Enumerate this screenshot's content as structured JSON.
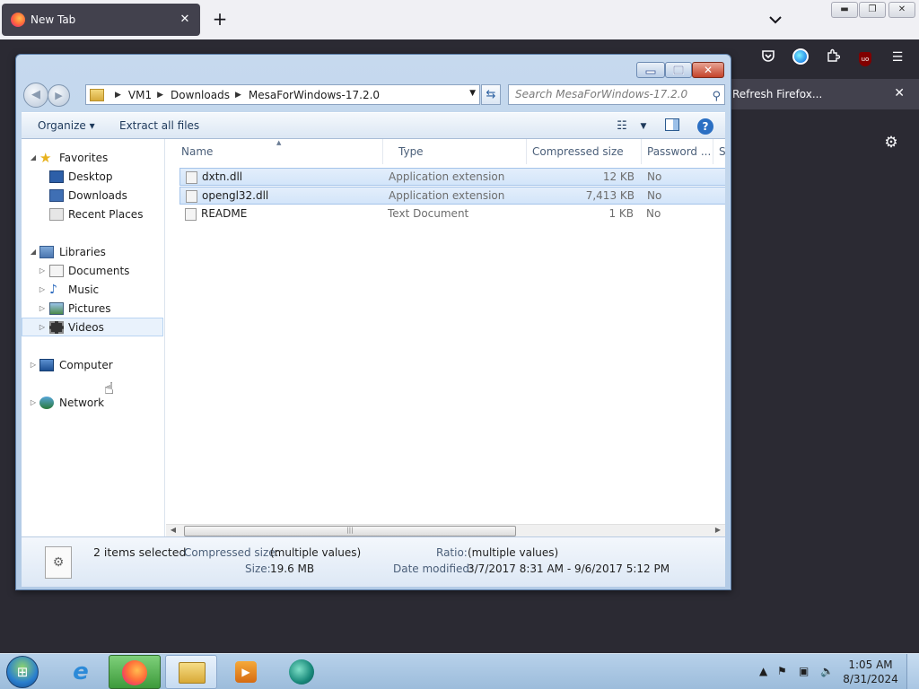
{
  "browser": {
    "tab_title": "New Tab",
    "tab_close": "✕",
    "new_tab": "+",
    "list_tabs": "⌄",
    "notification": {
      "label": "Refresh Firefox...",
      "close": "✕"
    }
  },
  "window": {
    "address_path": [
      "VM1",
      "Downloads",
      "MesaForWindows-17.2.0"
    ],
    "search_placeholder": "Search MesaForWindows-17.2.0",
    "toolbar": {
      "organize": "Organize ▾",
      "extract_all": "Extract all files"
    }
  },
  "navpane": {
    "favorites": {
      "label": "Favorites",
      "items": [
        "Desktop",
        "Downloads",
        "Recent Places"
      ]
    },
    "libraries": {
      "label": "Libraries",
      "items": [
        "Documents",
        "Music",
        "Pictures",
        "Videos"
      ]
    },
    "computer": "Computer",
    "network": "Network"
  },
  "filelist": {
    "columns": [
      "Name",
      "Type",
      "Compressed size",
      "Password ...",
      "Si"
    ],
    "rows": [
      {
        "name": "dxtn.dll",
        "type": "Application extension",
        "compressed_size": "12 KB",
        "password": "No",
        "selected": true
      },
      {
        "name": "opengl32.dll",
        "type": "Application extension",
        "compressed_size": "7,413 KB",
        "password": "No",
        "selected": true
      },
      {
        "name": "README",
        "type": "Text Document",
        "compressed_size": "1 KB",
        "password": "No",
        "selected": false
      }
    ]
  },
  "details": {
    "selection": "2 items selected",
    "compressed_size_label": "Compressed size:",
    "compressed_size_value": "(multiple values)",
    "size_label": "Size:",
    "size_value": "19.6 MB",
    "ratio_label": "Ratio:",
    "ratio_value": "(multiple values)",
    "date_label": "Date modified:",
    "date_value": "3/7/2017 8:31 AM - 9/6/2017 5:12 PM"
  },
  "taskbar": {
    "time": "1:05 AM",
    "date": "8/31/2024"
  }
}
